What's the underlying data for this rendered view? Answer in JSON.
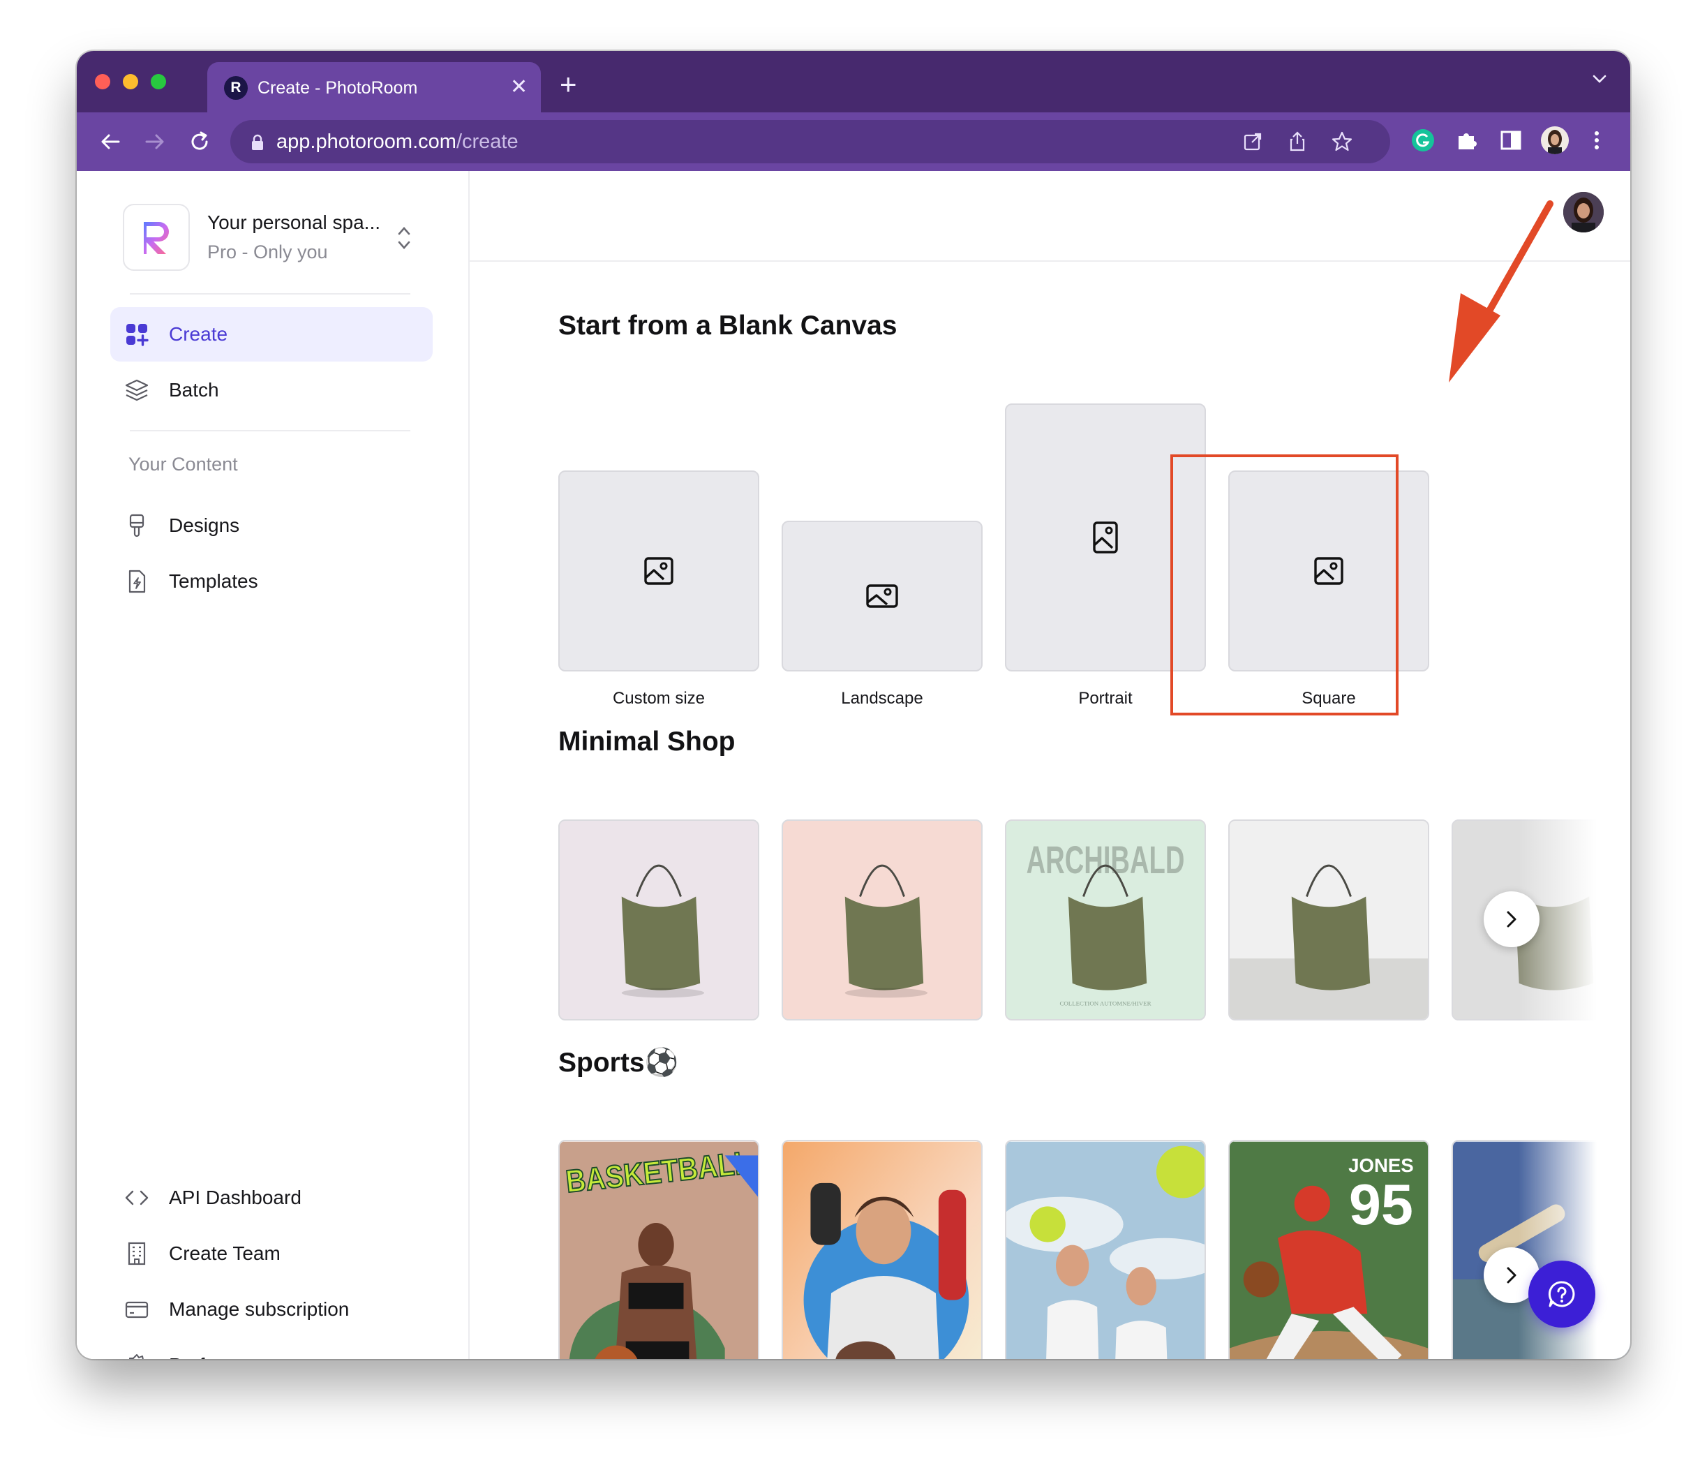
{
  "browser": {
    "tab_title": "Create - PhotoRoom",
    "tab_favicon_letter": "R",
    "url_host": "app.photoroom.com",
    "url_path": "/create",
    "traffic_light_colors": [
      "#ff5f57",
      "#febc2e",
      "#28c840"
    ],
    "tab_close_glyph": "✕",
    "new_tab_glyph": "+"
  },
  "workspace": {
    "name": "Your personal spa...",
    "plan": "Pro - Only you"
  },
  "sidebar": {
    "primary": [
      {
        "label": "Create",
        "icon": "grid-plus-icon",
        "active": true
      },
      {
        "label": "Batch",
        "icon": "layers-icon",
        "active": false
      }
    ],
    "content_section_label": "Your Content",
    "content": [
      {
        "label": "Designs",
        "icon": "brush-icon"
      },
      {
        "label": "Templates",
        "icon": "template-file-icon"
      }
    ],
    "bottom": [
      {
        "label": "API Dashboard",
        "icon": "code-icon"
      },
      {
        "label": "Create Team",
        "icon": "building-icon"
      },
      {
        "label": "Manage subscription",
        "icon": "credit-card-icon"
      },
      {
        "label": "Preferences",
        "icon": "gear-icon"
      }
    ]
  },
  "main": {
    "blank_canvas": {
      "title": "Start from a Blank Canvas",
      "options": [
        {
          "label": "Custom size",
          "shape": "square"
        },
        {
          "label": "Landscape",
          "shape": "landscape"
        },
        {
          "label": "Portrait",
          "shape": "portrait"
        },
        {
          "label": "Square",
          "shape": "square",
          "highlighted": true
        }
      ]
    },
    "minimal_shop": {
      "title": "Minimal Shop",
      "templates": [
        {
          "name": "bag-pink-background",
          "bg": "#ece4ea"
        },
        {
          "name": "bag-peach-background",
          "bg": "#f6dad3"
        },
        {
          "name": "bag-archibald",
          "bg": "#daeddf",
          "overlay_text": "ARCHIBALD",
          "caption": "COLLECTION AUTOMNE/HIVER"
        },
        {
          "name": "bag-studio-wall",
          "bg": "#eeeeee"
        },
        {
          "name": "bag-concrete",
          "bg": "#e6e6e6"
        }
      ]
    },
    "sports": {
      "title": "Sports",
      "title_emoji": "⚽",
      "templates": [
        {
          "name": "basketball",
          "overlay_text": "BASKETBALL"
        },
        {
          "name": "american-football"
        },
        {
          "name": "tennis"
        },
        {
          "name": "baseball",
          "overlay_name": "JONES",
          "overlay_number": "95"
        },
        {
          "name": "baseball-bat"
        }
      ]
    }
  },
  "colors": {
    "accent": "#4a3ad4",
    "chrome_dark": "#47296e",
    "chrome": "#6a45a2",
    "annotation": "#e24927",
    "help_button": "#3c1fd6"
  }
}
